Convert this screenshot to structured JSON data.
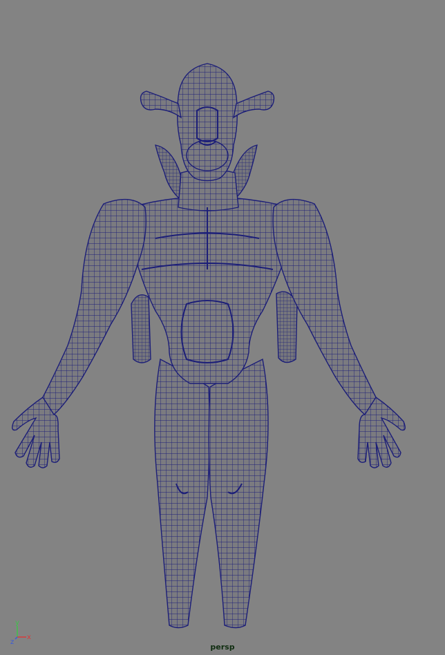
{
  "viewport": {
    "camera_name": "persp",
    "background_color": "#838383",
    "wireframe_color": "#1c1e78",
    "surface_color": "#7b7b80"
  },
  "axis_gizmo": {
    "x_label": "x",
    "y_label": "y",
    "z_label": "z",
    "x_color": "#d93a3a",
    "y_color": "#3fc24a",
    "z_color": "#3a5ad9"
  }
}
